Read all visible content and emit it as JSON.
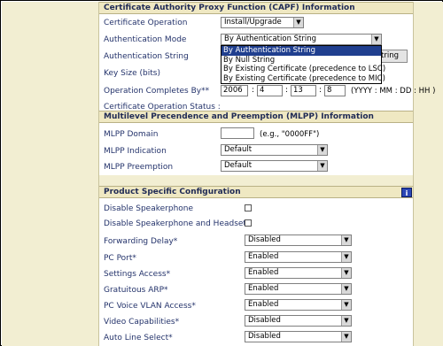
{
  "capf": {
    "header": "Certificate Authority Proxy Function (CAPF) Information",
    "cert_op_label": "Certificate Operation",
    "cert_op_value": "Install/Upgrade",
    "auth_mode_label": "Authentication Mode",
    "auth_mode_value": "By Authentication String",
    "auth_mode_options": [
      "By Authentication String",
      "By Null String",
      "By Existing Certificate (precedence to LSC)",
      "By Existing Certificate (precedence to MIC)"
    ],
    "auth_string_label": "Authentication String",
    "auth_string_button_tail": "tring",
    "key_size_label": "Key Size (bits)",
    "op_completes_label": "Operation Completes By**",
    "year": "2006",
    "month": "4",
    "day": "13",
    "hour": "8",
    "sep": ":",
    "date_format": "(YYYY : MM : DD : HH )",
    "status_label": "Certificate Operation Status :"
  },
  "mlpp": {
    "header": "Multilevel Precendence and Preemption (MLPP) Information",
    "domain_label": "MLPP Domain",
    "domain_value": "",
    "domain_note": "(e.g., \"0000FF\")",
    "indication_label": "MLPP Indication",
    "indication_value": "Default",
    "preemption_label": "MLPP Preemption",
    "preemption_value": "Default"
  },
  "product": {
    "header": "Product Specific Configuration",
    "info_icon": "i",
    "disable_speakerphone_label": "Disable Speakerphone",
    "disable_speaker_headset_label": "Disable Speakerphone and Headset",
    "forwarding_delay_label": "Forwarding Delay*",
    "forwarding_delay_value": "Disabled",
    "pc_port_label": "PC Port*",
    "pc_port_value": "Enabled",
    "settings_access_label": "Settings Access*",
    "settings_access_value": "Enabled",
    "gratuitous_arp_label": "Gratuitous ARP*",
    "gratuitous_arp_value": "Enabled",
    "pc_voice_vlan_label": "PC Voice VLAN Access*",
    "pc_voice_vlan_value": "Enabled",
    "video_label": "Video Capabilities*",
    "video_value": "Disabled",
    "auto_line_label": "Auto Line Select*",
    "auto_line_value": "Disabled"
  }
}
